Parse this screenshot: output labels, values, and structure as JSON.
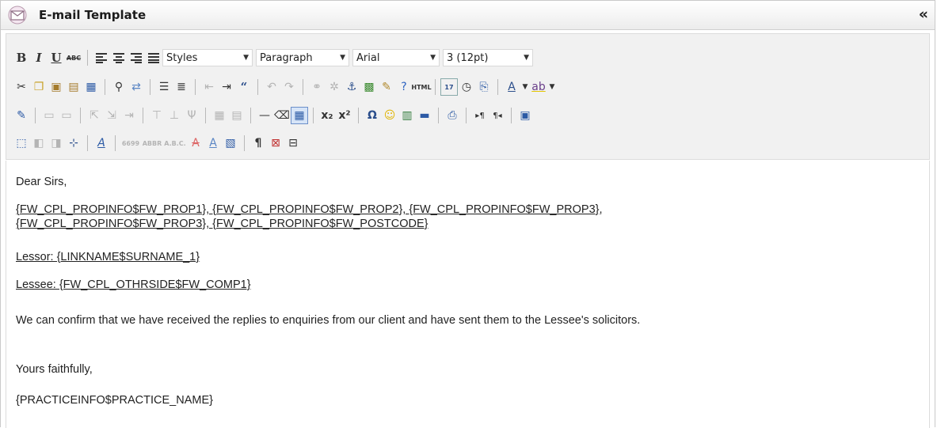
{
  "window": {
    "title": "E-mail Template",
    "collapse_glyph": "«"
  },
  "toolbar": {
    "styles_dropdown": "Styles",
    "format_dropdown": "Paragraph",
    "font_dropdown": "Arial",
    "size_dropdown": "3 (12pt)",
    "bold_label": "B",
    "italic_label": "I",
    "underline_label": "U",
    "strike_label": "ABC",
    "html_label": "HTML",
    "date_label": "17",
    "abbr_labels": [
      "6699",
      "ABBR",
      "A.B.C."
    ]
  },
  "content": {
    "greeting": "Dear Sirs,",
    "address_line1": "{FW_CPL_PROPINFO$FW_PROP1}, {FW_CPL_PROPINFO$FW_PROP2}, {FW_CPL_PROPINFO$FW_PROP3},",
    "address_line2": "{FW_CPL_PROPINFO$FW_PROP3}, {FW_CPL_PROPINFO$FW_POSTCODE}",
    "lessor": "Lessor: {LINKNAME$SURNAME_1}",
    "lessee": "Lessee: {FW_CPL_OTHRSIDE$FW_COMP1}",
    "body": "We can confirm that we have received the replies to enquiries from our client and have sent them to the Lessee's solicitors.",
    "signoff": "Yours faithfully,",
    "signature": "{PRACTICEINFO$PRACTICE_NAME}"
  }
}
